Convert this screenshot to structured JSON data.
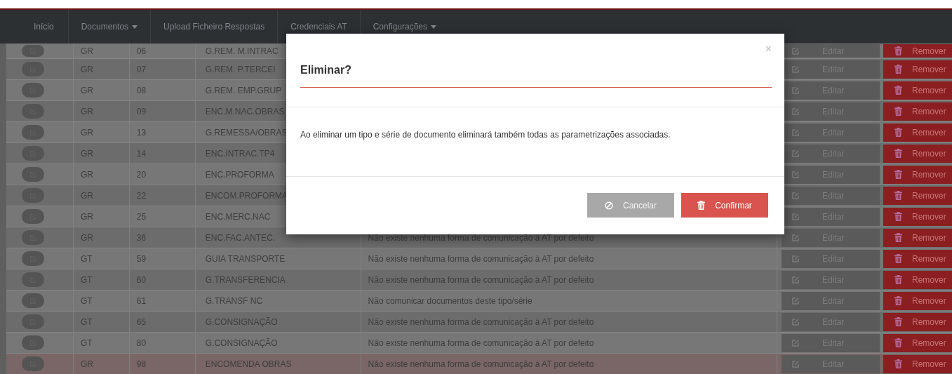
{
  "nav": {
    "items": [
      {
        "label": "Início",
        "dropdown": false
      },
      {
        "label": "Documentos",
        "dropdown": true
      },
      {
        "label": "Upload Ficheiro Respostas",
        "dropdown": false
      },
      {
        "label": "Credenciais AT",
        "dropdown": false
      },
      {
        "label": "Configurações",
        "dropdown": true
      }
    ]
  },
  "table": {
    "rows": [
      {
        "type": "GR",
        "number": "06",
        "description": "G.REM. M.INTRAC",
        "edit": "Editar",
        "remove": "Remover",
        "highlighted": false
      },
      {
        "type": "GR",
        "number": "07",
        "description": "G.REM. P.TERCEI",
        "edit": "Editar",
        "remove": "Remover",
        "highlighted": false
      },
      {
        "type": "GR",
        "number": "08",
        "description": "G.REM. EMP.GRUP",
        "edit": "Editar",
        "remove": "Remover",
        "highlighted": false
      },
      {
        "type": "GR",
        "number": "09",
        "description": "ENC.M.NAC.OBRAS",
        "edit": "Editar",
        "remove": "Remover",
        "highlighted": false
      },
      {
        "type": "GR",
        "number": "13",
        "description": "G.REMESSA/OBRAS",
        "edit": "Editar",
        "remove": "Remover",
        "highlighted": false
      },
      {
        "type": "GR",
        "number": "14",
        "description": "ENC.INTRAC.TP4",
        "edit": "Editar",
        "remove": "Remover",
        "highlighted": false
      },
      {
        "type": "GR",
        "number": "20",
        "description": "ENC.PROFORMA",
        "edit": "Editar",
        "remove": "Remover",
        "highlighted": false
      },
      {
        "type": "GR",
        "number": "22",
        "description": "ENCOM.PROFORMA",
        "edit": "Editar",
        "remove": "Remover",
        "highlighted": false
      },
      {
        "type": "GR",
        "number": "25",
        "description": "ENC.MERC.NAC",
        "edit": "Editar",
        "remove": "Remover",
        "highlighted": false
      },
      {
        "type": "GR",
        "number": "36",
        "description": "ENC.FAC.ANTEC.",
        "communication": "Não existe nenhuma forma de comunicação à AT por defeito",
        "edit": "Editar",
        "remove": "Remover",
        "highlighted": false
      },
      {
        "type": "GT",
        "number": "59",
        "description": "GUIA TRANSPORTE",
        "communication": "Não existe nenhuma forma de comunicação à AT por defeito",
        "edit": "Editar",
        "remove": "Remover",
        "highlighted": false
      },
      {
        "type": "GT",
        "number": "60",
        "description": "G.TRANSFERENCIA",
        "communication": "Não existe nenhuma forma de comunicação à AT por defeito",
        "edit": "Editar",
        "remove": "Remover",
        "highlighted": false
      },
      {
        "type": "GT",
        "number": "61",
        "description": "G.TRANSF NC",
        "communication": "Não comunicar documentos deste tipo/série",
        "edit": "Editar",
        "remove": "Remover",
        "highlighted": false
      },
      {
        "type": "GT",
        "number": "65",
        "description": "G.CONSIGNAÇÃO",
        "communication": "Não existe nenhuma forma de comunicação à AT por defeito",
        "edit": "Editar",
        "remove": "Remover",
        "highlighted": false
      },
      {
        "type": "GT",
        "number": "80",
        "description": "G.CONSIGNAÇÃO",
        "communication": "Não existe nenhuma forma de comunicação à AT por defeito",
        "edit": "Editar",
        "remove": "Remover",
        "highlighted": false
      },
      {
        "type": "GR",
        "number": "98",
        "description": "ENCOMENDA OBRAS",
        "communication": "Não existe nenhuma forma de comunicação à AT por defeito",
        "edit": "Editar",
        "remove": "Remover",
        "highlighted": true
      }
    ]
  },
  "modal": {
    "title": "Eliminar?",
    "close": "×",
    "message": "Ao eliminar um tipo e série de documento eliminará também todas as parametrizações associadas.",
    "buttons": [
      {
        "label": "Cancelar",
        "kind": "cancel"
      },
      {
        "label": "Confirmar",
        "kind": "confirm"
      }
    ]
  }
}
